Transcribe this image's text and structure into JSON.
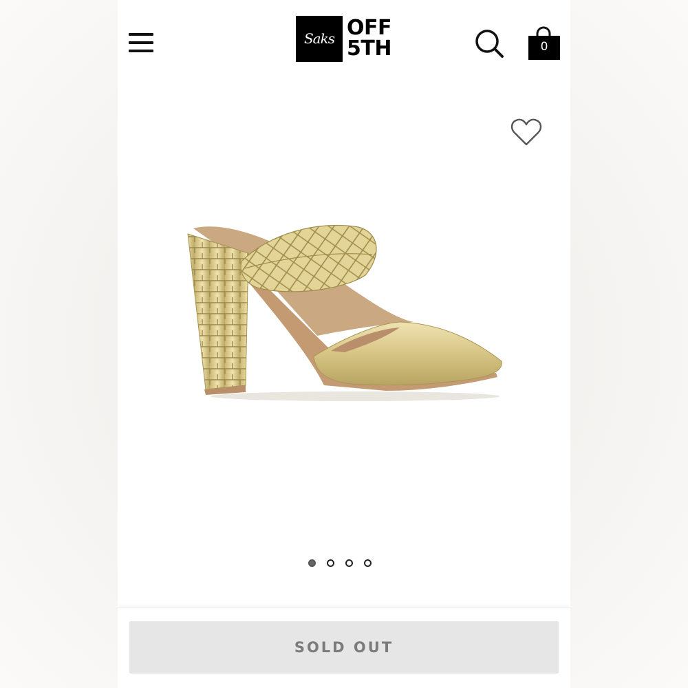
{
  "header": {
    "menu_icon": "hamburger-menu-icon",
    "logo": {
      "script_text": "Saks",
      "line1": "OFF",
      "line2": "5TH"
    },
    "search_icon": "search-icon",
    "bag_icon": "shopping-bag-icon",
    "bag_count": "0"
  },
  "product": {
    "wishlist_icon": "heart-outline-icon",
    "image_name": "gold-woven-mule-image",
    "carousel": {
      "total": 4,
      "active_index": 0
    }
  },
  "cta": {
    "label": "SOLD OUT"
  },
  "colors": {
    "product_gold": "#d9c98f",
    "button_bg": "#e6e6e6",
    "button_text": "#7b7b7b",
    "brand_black": "#000000"
  }
}
